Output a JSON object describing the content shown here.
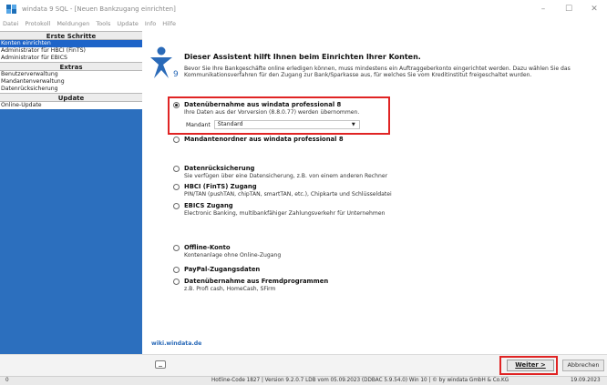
{
  "window": {
    "title": "windata 9 SQL - [Neuen Bankzugang einrichten]",
    "controls": {
      "minimize": "–",
      "maximize": "☐",
      "close": "✕"
    }
  },
  "menubar": [
    "Datei",
    "Protokoll",
    "Meldungen",
    "Tools",
    "Update",
    "Info",
    "Hilfe"
  ],
  "sidebar": {
    "sections": [
      {
        "header": "Erste Schritte",
        "items": [
          {
            "label": "Konten einrichten",
            "active": true
          },
          {
            "label": "Administrator für HBCI (FinTS)",
            "active": false
          },
          {
            "label": "Administrator für EBICS",
            "active": false
          }
        ]
      },
      {
        "header": "Extras",
        "items": [
          {
            "label": "Benutzerverwaltung",
            "active": false
          },
          {
            "label": "Mandantenverwaltung",
            "active": false
          },
          {
            "label": "Datenrücksicherung",
            "active": false
          }
        ]
      },
      {
        "header": "Update",
        "items": [
          {
            "label": "Online-Update",
            "active": false
          }
        ]
      }
    ]
  },
  "main": {
    "heading": "Dieser Assistent hilft Ihnen beim Einrichten Ihrer Konten.",
    "intro": "Bevor Sie Ihre Bankgeschäfte online erledigen können, muss mindestens ein Auftraggeberkonto eingerichtet werden. Dazu wählen Sie das Kommunikationsverfahren für den Zugang zur Bank/Sparkasse aus, für welches Sie vom Kreditinstitut freigeschaltet wurden.",
    "options": {
      "datenuebernahme": {
        "title": "Datenübernahme aus windata professional 8",
        "desc": "Ihre Daten aus der Vorversion (8.8.0.77) werden übernommen.",
        "checked": true
      },
      "mandantenordner": {
        "title": "Mandantenordner aus windata professional 8"
      },
      "datenruecksicherung": {
        "title": "Datenrücksicherung",
        "desc": "Sie verfügen über eine Datensicherung, z.B. von einem anderen Rechner"
      },
      "hbci": {
        "title": "HBCI (FinTS) Zugang",
        "desc": "PIN/TAN (pushTAN, chipTAN, smartTAN, etc.), Chipkarte und Schlüsseldatei"
      },
      "ebics": {
        "title": "EBICS Zugang",
        "desc": "Electronic Banking, multibankfähiger Zahlungsverkehr für Unternehmen"
      },
      "offline": {
        "title": "Offline-Konto",
        "desc": "Kontenanlage ohne Online-Zugang"
      },
      "paypal": {
        "title": "PayPal-Zugangsdaten"
      },
      "fremd": {
        "title": "Datenübernahme aus Fremdprogrammen",
        "desc": "z.B. Profi cash, HomeCash, SFirm"
      }
    },
    "mandant": {
      "label": "Mandant",
      "value": "Standard"
    },
    "wiki_link": "wiki.windata.de",
    "logo_number": "9"
  },
  "buttons": {
    "next": "Weiter >",
    "cancel": "Abbrechen"
  },
  "statusbar": {
    "left": "0",
    "main": "Hotline-Code 1827 | Version 9.2.0.7 LDB vom 05.09.2023 (DDBAC 5.9.54.0)  Win 10  |  © by windata GmbH & Co.KG",
    "date": "19.09.2023"
  },
  "colors": {
    "sidebar_bg": "#2c6fbe",
    "active_item": "#1e64c8",
    "highlight_border": "#e02424",
    "logo_blue": "#2a6ab8"
  }
}
